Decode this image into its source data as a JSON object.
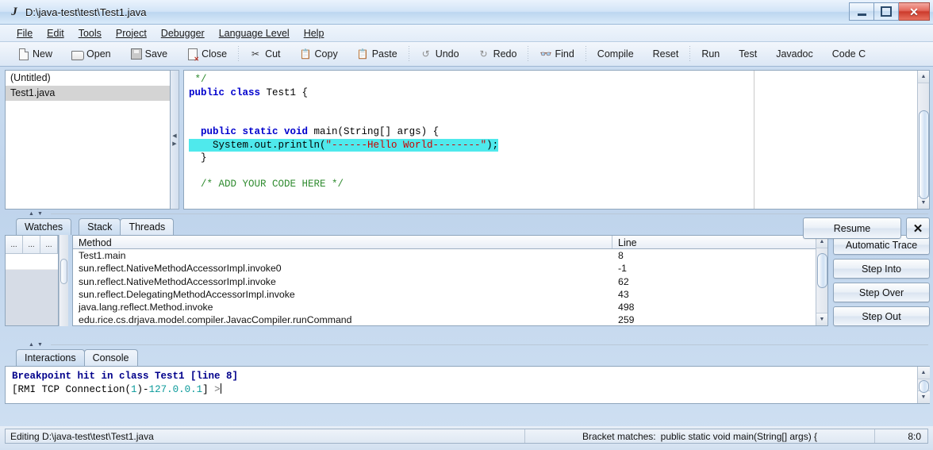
{
  "window": {
    "title": "D:\\java-test\\test\\Test1.java",
    "app_icon": "drjava-icon",
    "controls": {
      "minimize": "minimize-icon",
      "maximize": "maximize-icon",
      "close": "close-icon"
    }
  },
  "menubar": {
    "items": [
      {
        "label": "File"
      },
      {
        "label": "Edit"
      },
      {
        "label": "Tools"
      },
      {
        "label": "Project"
      },
      {
        "label": "Debugger"
      },
      {
        "label": "Language Level"
      },
      {
        "label": "Help"
      }
    ]
  },
  "toolbar": {
    "items": [
      {
        "label": "New",
        "icon": "new-document-icon"
      },
      {
        "label": "Open",
        "icon": "open-folder-icon"
      },
      {
        "label": "Save",
        "icon": "save-disk-icon"
      },
      {
        "label": "Close",
        "icon": "close-document-icon"
      },
      {
        "label": "Cut",
        "icon": "scissors-icon"
      },
      {
        "label": "Copy",
        "icon": "copy-icon"
      },
      {
        "label": "Paste",
        "icon": "clipboard-icon"
      },
      {
        "label": "Undo",
        "icon": "undo-arrow-icon"
      },
      {
        "label": "Redo",
        "icon": "redo-arrow-icon"
      },
      {
        "label": "Find",
        "icon": "binoculars-icon"
      },
      {
        "label": "Compile",
        "icon": ""
      },
      {
        "label": "Reset",
        "icon": ""
      },
      {
        "label": "Run",
        "icon": ""
      },
      {
        "label": "Test",
        "icon": ""
      },
      {
        "label": "Javadoc",
        "icon": ""
      },
      {
        "label": "Code C",
        "icon": ""
      }
    ]
  },
  "file_panel": {
    "items": [
      {
        "label": "(Untitled)",
        "selected": false
      },
      {
        "label": "Test1.java",
        "selected": true
      }
    ]
  },
  "editor": {
    "lines": [
      [
        {
          "t": " */",
          "c": "cmt"
        }
      ],
      [
        {
          "t": "public class ",
          "c": "kw"
        },
        {
          "t": "Test1 {",
          "c": "pln"
        }
      ],
      [
        {
          "t": "",
          "c": "pln"
        }
      ],
      [
        {
          "t": "",
          "c": "pln"
        }
      ],
      [
        {
          "t": "  ",
          "c": "pln"
        },
        {
          "t": "public static void ",
          "c": "kw"
        },
        {
          "t": "main(String[] args) {",
          "c": "pln"
        }
      ],
      [
        {
          "t": "    System.out.println(",
          "c": "pln",
          "hl": true
        },
        {
          "t": "\"------Hello World--------\"",
          "c": "str",
          "hl": true
        },
        {
          "t": ");",
          "c": "pln",
          "hl": true
        }
      ],
      [
        {
          "t": "  }",
          "c": "pln"
        }
      ],
      [
        {
          "t": "",
          "c": "pln"
        }
      ],
      [
        {
          "t": "  /* ADD YOUR CODE HERE */",
          "c": "cmt"
        }
      ]
    ]
  },
  "debugger": {
    "left_tabs": [
      {
        "label": "Watches",
        "active": true
      }
    ],
    "right_tabs": [
      {
        "label": "Stack",
        "active": true
      },
      {
        "label": "Threads",
        "active": false
      }
    ],
    "watches_columns": [
      "...",
      "...",
      "..."
    ],
    "stack_headers": {
      "method": "Method",
      "line": "Line"
    },
    "stack_rows": [
      {
        "method": "Test1.main",
        "line": "8"
      },
      {
        "method": "sun.reflect.NativeMethodAccessorImpl.invoke0",
        "line": "-1"
      },
      {
        "method": "sun.reflect.NativeMethodAccessorImpl.invoke",
        "line": "62"
      },
      {
        "method": "sun.reflect.DelegatingMethodAccessorImpl.invoke",
        "line": "43"
      },
      {
        "method": "java.lang.reflect.Method.invoke",
        "line": "498"
      },
      {
        "method": "edu.rice.cs.drjava.model.compiler.JavacCompiler.runCommand",
        "line": "259"
      }
    ],
    "buttons": [
      {
        "label": "Resume"
      },
      {
        "label": "Automatic Trace"
      },
      {
        "label": "Step Into"
      },
      {
        "label": "Step Over"
      },
      {
        "label": "Step Out"
      }
    ],
    "close_label": "✕"
  },
  "interactions": {
    "tabs": [
      {
        "label": "Interactions",
        "active": true
      },
      {
        "label": "Console",
        "active": false
      }
    ],
    "breakpoint_line": "Breakpoint hit in class Test1   [line 8]",
    "prompt_prefix": "[RMI TCP Connection(",
    "prompt_num": "1",
    "prompt_dash": ")-",
    "prompt_ip": "127.0.0.1",
    "prompt_suffix": "] ",
    "prompt_chevron": ">"
  },
  "status": {
    "left": "Editing D:\\java-test\\test\\Test1.java",
    "bracket_label": "Bracket matches:",
    "bracket_value": "public static void main(String[] args) {",
    "position": "8:0"
  },
  "colors": {
    "highlight": "#4fe9ec",
    "keyword": "#0000cd",
    "comment": "#2f8b2f",
    "string": "#cc0000",
    "close_button": "#cc3a2b"
  }
}
